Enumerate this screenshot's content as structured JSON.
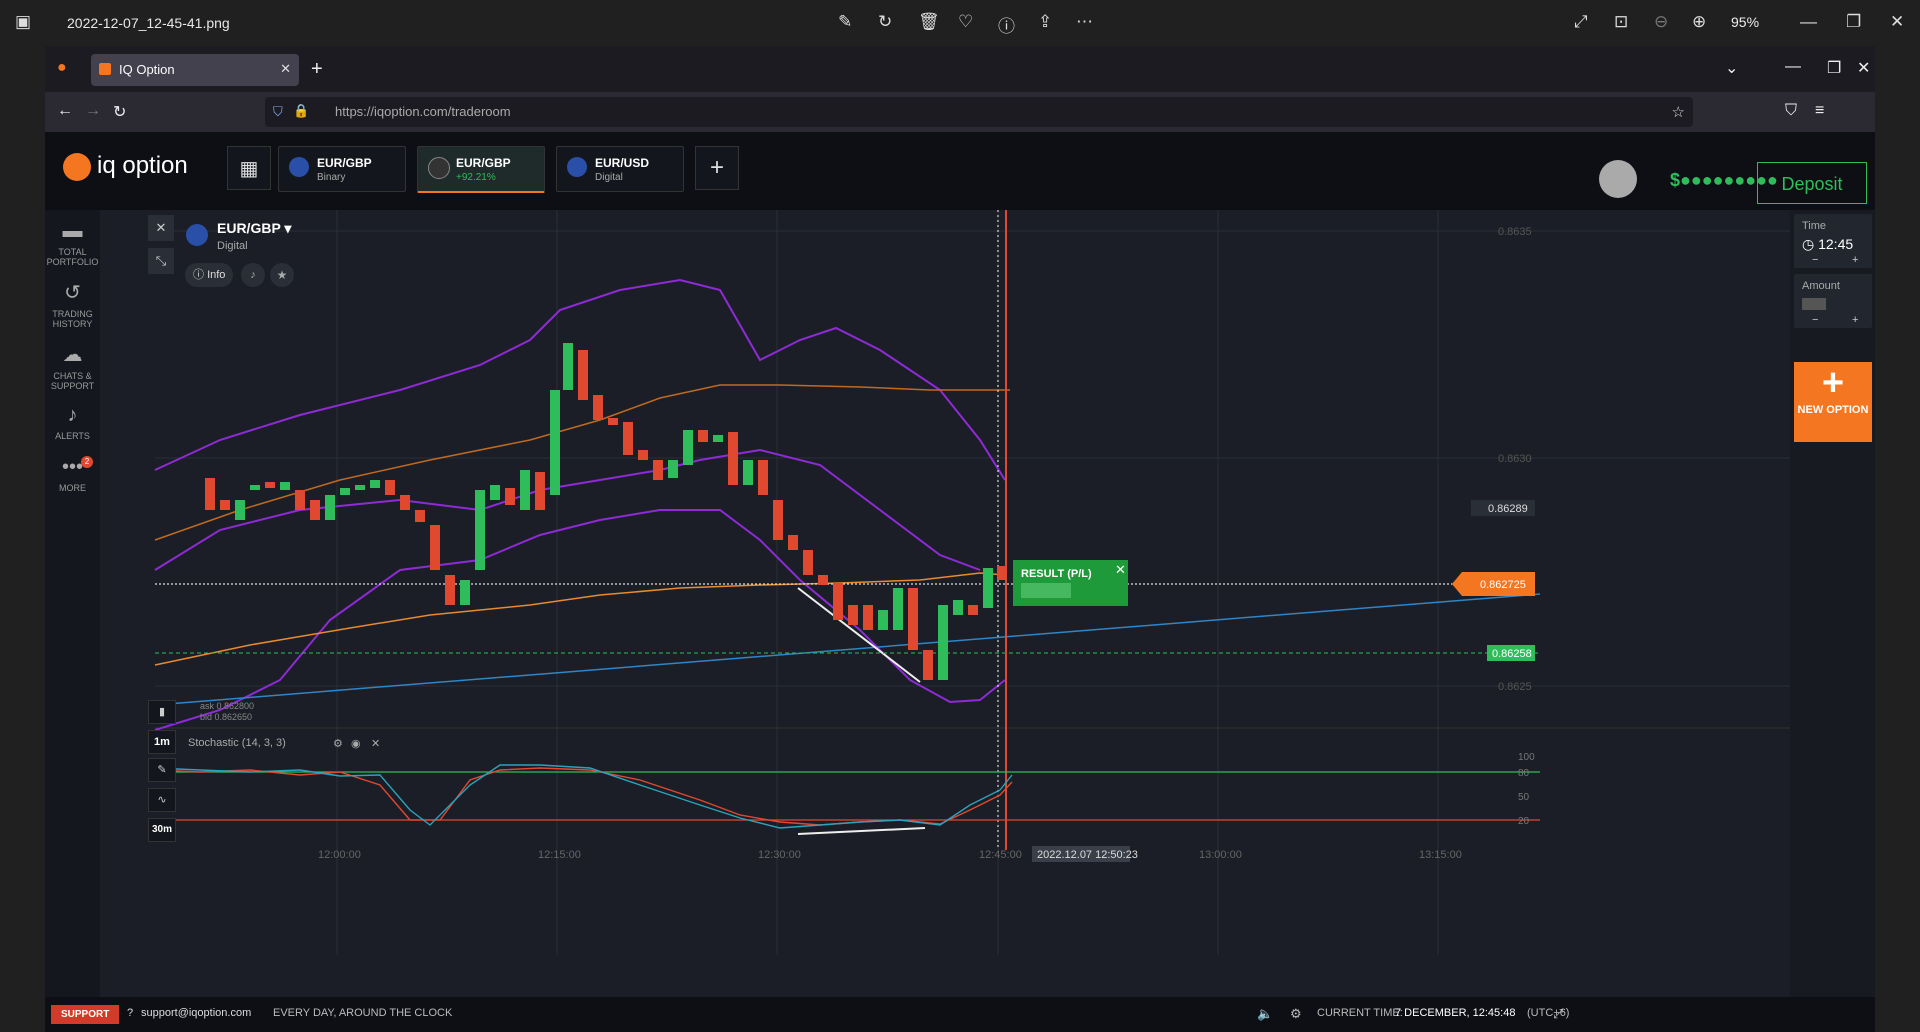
{
  "viewer": {
    "filename": "2022-12-07_12-45-41.png",
    "zoom": "95%"
  },
  "browser": {
    "tab_title": "IQ Option",
    "url": "https://iqoption.com/traderoom"
  },
  "header": {
    "logo": "iq option",
    "tabs": [
      {
        "name": "EUR/GBP",
        "sub": "Binary"
      },
      {
        "name": "EUR/GBP",
        "sub": "+92.21%"
      },
      {
        "name": "EUR/USD",
        "sub": "Digital"
      }
    ],
    "balance": "$●●●●●●●●●",
    "deposit": "Deposit"
  },
  "sidebar": [
    {
      "label": "TOTAL PORTFOLIO",
      "icon": "briefcase-icon"
    },
    {
      "label": "TRADING HISTORY",
      "icon": "history-icon"
    },
    {
      "label": "CHATS & SUPPORT",
      "icon": "chat-icon"
    },
    {
      "label": "ALERTS",
      "icon": "bell-icon"
    },
    {
      "label": "MORE",
      "icon": "more-icon",
      "badge": "2"
    }
  ],
  "asset": {
    "name": "EUR/GBP",
    "type": "Digital",
    "info": "Info"
  },
  "price_labels": {
    "current": "0.862725",
    "alert": "0.86289",
    "green": "0.86258",
    "ask": "ask 0.862800",
    "bid": "bid 0.862650"
  },
  "axis": {
    "y": [
      "0.8635",
      "0.8630",
      "0.8625"
    ],
    "x": [
      "12:00:00",
      "12:15:00",
      "12:30:00",
      "12:45:00",
      "13:00:00",
      "13:15:00"
    ],
    "cursor_time": "2022.12.07 12:50:23",
    "stoch_levels": [
      "100",
      "80",
      "50",
      "20"
    ]
  },
  "result": {
    "label": "RESULT (P/L)"
  },
  "indicator": {
    "label": "Stochastic (14, 3, 3)"
  },
  "timeframes": [
    "1m",
    "30m"
  ],
  "right_panel": {
    "time_label": "Time",
    "time_value": "12:45",
    "amount_label": "Amount",
    "new_option": "NEW OPTION"
  },
  "footer": {
    "support": "SUPPORT",
    "email": "support@iqoption.com",
    "hours": "EVERY DAY, AROUND THE CLOCK",
    "current_time": "CURRENT TIME:",
    "time_value": "7 DECEMBER, 12:45:48",
    "tz": "(UTC+6)"
  },
  "colors": {
    "accent": "#f47621",
    "green": "#2ebd5a",
    "red": "#e0492f",
    "bb": "#9b30d9"
  }
}
